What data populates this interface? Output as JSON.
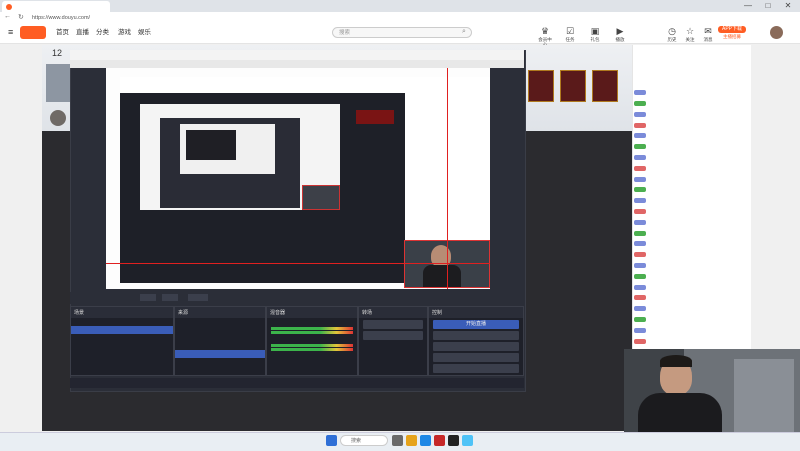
{
  "browser": {
    "tab_title": "",
    "address": "https://www.douyu.com/",
    "window_controls": [
      "—",
      "□",
      "✕"
    ]
  },
  "site": {
    "nav": [
      "首页",
      "直播",
      "分类",
      "游戏",
      "娱乐"
    ],
    "search_placeholder": "搜索",
    "header_icons": [
      {
        "icon": "crown-icon",
        "label": "会员中心"
      },
      {
        "icon": "task-icon",
        "label": "任务"
      },
      {
        "icon": "box-icon",
        "label": "礼包"
      },
      {
        "icon": "play-icon",
        "label": "播放"
      },
      {
        "icon": "clock-icon",
        "label": "历史"
      },
      {
        "icon": "star-icon",
        "label": "关注"
      },
      {
        "icon": "mail-icon",
        "label": "消息"
      },
      {
        "icon": "tv-icon",
        "label": "开播"
      }
    ],
    "download_label": "APP下载",
    "cast_label": "主播招募",
    "room_number": "12"
  },
  "obs": {
    "title": "",
    "menu": [],
    "source_label": "",
    "ctrl_buttons": [],
    "docks": {
      "scenes": {
        "title": "场景",
        "items": [],
        "selected": 0
      },
      "sources": {
        "title": "来源",
        "items": [],
        "selected": 4
      },
      "mixer": {
        "title": "混音器",
        "tracks": [
          {
            "name": "",
            "db": ""
          },
          {
            "name": "",
            "db": ""
          }
        ]
      },
      "transitions": {
        "title": "转场",
        "value": "",
        "duration": ""
      },
      "controls": {
        "title": "控制",
        "buttons": [
          "开始直播",
          "",
          "",
          "",
          ""
        ]
      }
    },
    "status": ""
  },
  "gifts": [
    "",
    "",
    ""
  ],
  "sidebar": {
    "tabs": [
      "",
      "",
      "",
      ""
    ],
    "chat": [
      {
        "badge": "b",
        "text": ""
      },
      {
        "badge": "g",
        "text": ""
      },
      {
        "badge": "b",
        "text": ""
      },
      {
        "badge": "r",
        "text": ""
      },
      {
        "badge": "b",
        "text": ""
      },
      {
        "badge": "g",
        "text": ""
      },
      {
        "badge": "b",
        "text": ""
      },
      {
        "badge": "r",
        "text": ""
      },
      {
        "badge": "b",
        "text": ""
      },
      {
        "badge": "g",
        "text": ""
      },
      {
        "badge": "b",
        "text": ""
      },
      {
        "badge": "r",
        "text": ""
      },
      {
        "badge": "b",
        "text": ""
      },
      {
        "badge": "g",
        "text": ""
      },
      {
        "badge": "b",
        "text": ""
      },
      {
        "badge": "r",
        "text": ""
      },
      {
        "badge": "b",
        "text": ""
      },
      {
        "badge": "g",
        "text": ""
      },
      {
        "badge": "b",
        "text": ""
      },
      {
        "badge": "r",
        "text": ""
      },
      {
        "badge": "b",
        "text": ""
      },
      {
        "badge": "g",
        "text": ""
      },
      {
        "badge": "b",
        "text": ""
      },
      {
        "badge": "r",
        "text": ""
      },
      {
        "badge": "b",
        "text": ""
      },
      {
        "badge": "g",
        "text": ""
      },
      {
        "badge": "b",
        "text": ""
      },
      {
        "badge": "r",
        "text": ""
      }
    ]
  },
  "taskbar": {
    "search_placeholder": "搜索",
    "weather": "",
    "weather_sub": ""
  },
  "colors": {
    "accent": "#ff5d23",
    "obs_select": "#3a5db8",
    "source_border": "#e02020"
  }
}
